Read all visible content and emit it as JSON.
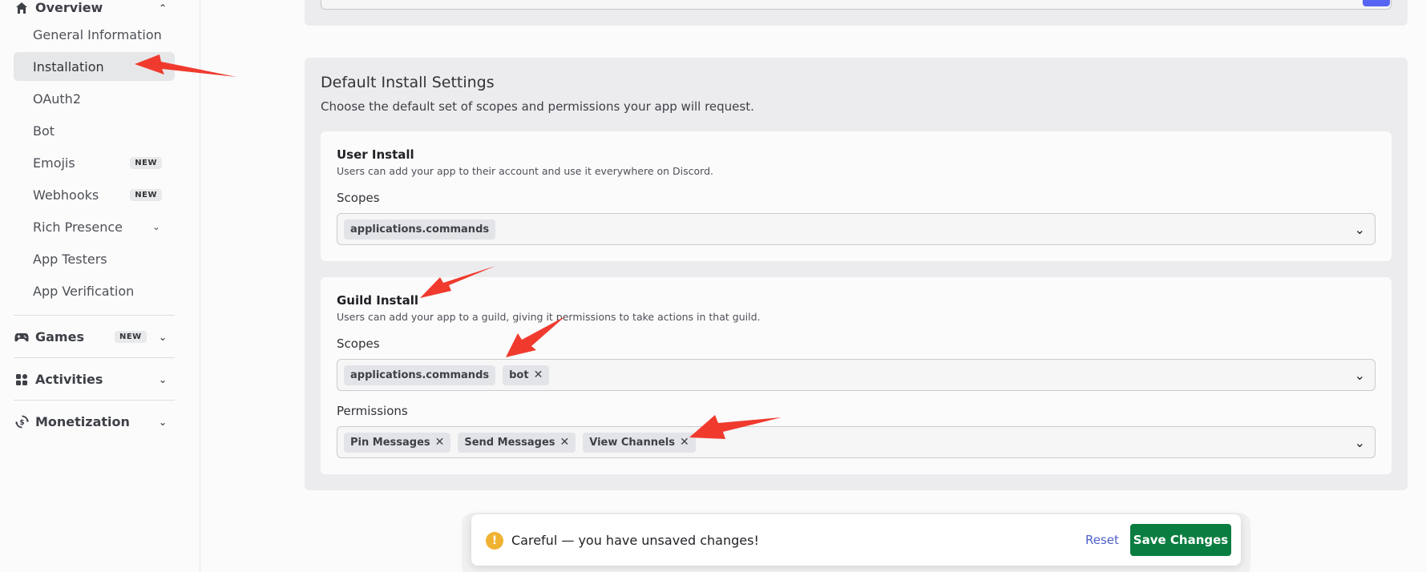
{
  "sidebar": {
    "overview": {
      "label": "Overview",
      "icon": "home-icon"
    },
    "items": [
      {
        "label": "General Information"
      },
      {
        "label": "Installation"
      },
      {
        "label": "OAuth2"
      },
      {
        "label": "Bot"
      },
      {
        "label": "Emojis",
        "badge": "NEW"
      },
      {
        "label": "Webhooks",
        "badge": "NEW"
      },
      {
        "label": "Rich Presence"
      },
      {
        "label": "App Testers"
      },
      {
        "label": "App Verification"
      }
    ],
    "games": {
      "label": "Games",
      "badge": "NEW",
      "icon": "gamepad-icon"
    },
    "activities": {
      "label": "Activities",
      "icon": "activities-icon"
    },
    "monetization": {
      "label": "Monetization",
      "icon": "monetization-icon"
    }
  },
  "settings": {
    "title": "Default Install Settings",
    "description": "Choose the default set of scopes and permissions your app will request.",
    "user_install": {
      "title": "User Install",
      "description": "Users can add your app to their account and use it everywhere on Discord.",
      "scopes_label": "Scopes",
      "scopes": [
        "applications.commands"
      ]
    },
    "guild_install": {
      "title": "Guild Install",
      "description": "Users can add your app to a guild, giving it permissions to take actions in that guild.",
      "scopes_label": "Scopes",
      "scopes": [
        "applications.commands",
        "bot"
      ],
      "permissions_label": "Permissions",
      "permissions": [
        "Pin Messages",
        "Send Messages",
        "View Channels"
      ]
    }
  },
  "toast": {
    "message": "Careful — you have unsaved changes!",
    "reset_label": "Reset",
    "save_label": "Save Changes"
  },
  "colors": {
    "accent": "#5865f2",
    "save_button": "#0a7d40",
    "warning": "#f0b232",
    "annotation_arrow": "#f03a2e"
  }
}
